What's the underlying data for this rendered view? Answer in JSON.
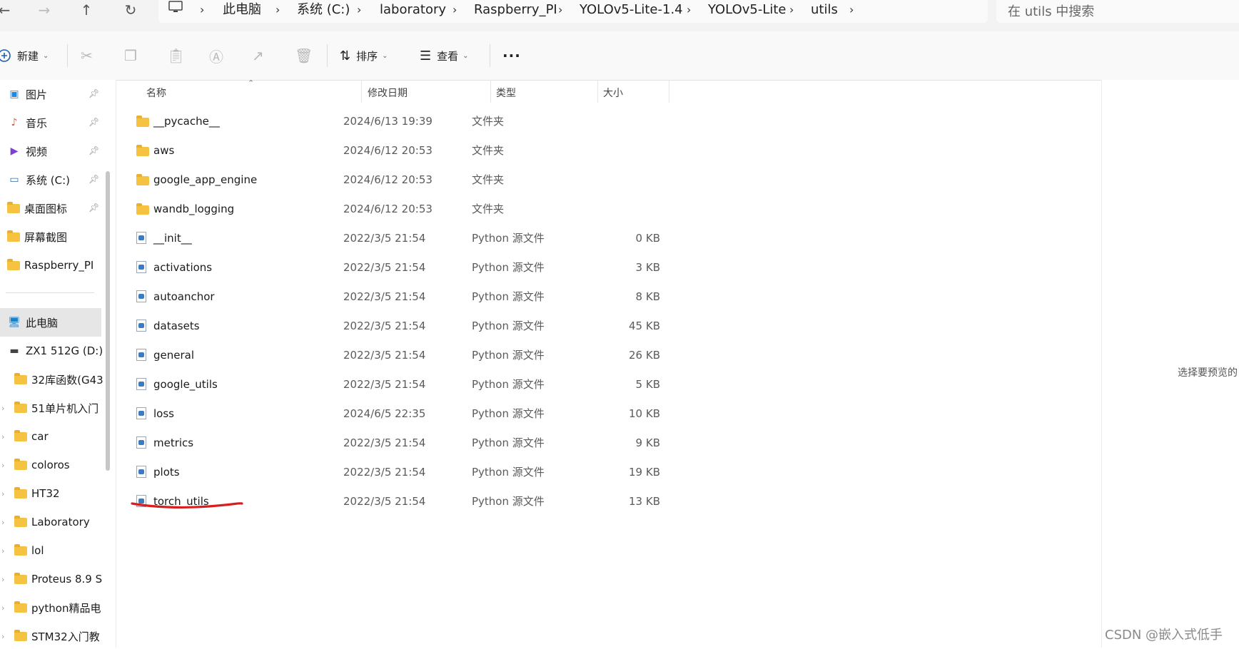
{
  "breadcrumb": [
    "此电脑",
    "系统 (C:)",
    "laboratory",
    "Raspberry_PI",
    "YOLOv5-Lite-1.4",
    "YOLOv5-Lite",
    "utils"
  ],
  "search": {
    "placeholder": "在 utils 中搜索"
  },
  "toolbar": {
    "new_label": "新建",
    "sort_label": "排序",
    "view_label": "查看",
    "more_label": "···"
  },
  "sidebar": {
    "quick_access": [
      {
        "label": "图片",
        "icon": "pictures-icon"
      },
      {
        "label": "音乐",
        "icon": "music-icon"
      },
      {
        "label": "视频",
        "icon": "videos-icon"
      },
      {
        "label": "系统 (C:)",
        "icon": "drive-icon"
      },
      {
        "label": "桌面图标",
        "icon": "folder-icon"
      },
      {
        "label": "屏幕截图",
        "icon": "folder-icon"
      },
      {
        "label": "Raspberry_PI",
        "icon": "folder-icon"
      }
    ],
    "this_pc": "此电脑",
    "drive_d": "ZX1 512G (D:)",
    "folders": [
      "32库函数(G43",
      "51单片机入门",
      "car",
      "coloros",
      "HT32",
      "Laboratory",
      "lol",
      "Proteus 8.9 S",
      "python精品电",
      "STM32入门教"
    ]
  },
  "columns": {
    "name": "名称",
    "date": "修改日期",
    "type": "类型",
    "size": "大小"
  },
  "files": [
    {
      "name": "__pycache__",
      "date": "2024/6/13 19:39",
      "type": "文件夹",
      "size": "",
      "kind": "folder"
    },
    {
      "name": "aws",
      "date": "2024/6/12 20:53",
      "type": "文件夹",
      "size": "",
      "kind": "folder"
    },
    {
      "name": "google_app_engine",
      "date": "2024/6/12 20:53",
      "type": "文件夹",
      "size": "",
      "kind": "folder"
    },
    {
      "name": "wandb_logging",
      "date": "2024/6/12 20:53",
      "type": "文件夹",
      "size": "",
      "kind": "folder"
    },
    {
      "name": "__init__",
      "date": "2022/3/5 21:54",
      "type": "Python 源文件",
      "size": "0 KB",
      "kind": "python"
    },
    {
      "name": "activations",
      "date": "2022/3/5 21:54",
      "type": "Python 源文件",
      "size": "3 KB",
      "kind": "python"
    },
    {
      "name": "autoanchor",
      "date": "2022/3/5 21:54",
      "type": "Python 源文件",
      "size": "8 KB",
      "kind": "python"
    },
    {
      "name": "datasets",
      "date": "2022/3/5 21:54",
      "type": "Python 源文件",
      "size": "45 KB",
      "kind": "python"
    },
    {
      "name": "general",
      "date": "2022/3/5 21:54",
      "type": "Python 源文件",
      "size": "26 KB",
      "kind": "python"
    },
    {
      "name": "google_utils",
      "date": "2022/3/5 21:54",
      "type": "Python 源文件",
      "size": "5 KB",
      "kind": "python"
    },
    {
      "name": "loss",
      "date": "2024/6/5 22:35",
      "type": "Python 源文件",
      "size": "10 KB",
      "kind": "python"
    },
    {
      "name": "metrics",
      "date": "2022/3/5 21:54",
      "type": "Python 源文件",
      "size": "9 KB",
      "kind": "python"
    },
    {
      "name": "plots",
      "date": "2022/3/5 21:54",
      "type": "Python 源文件",
      "size": "19 KB",
      "kind": "python"
    },
    {
      "name": "torch_utils",
      "date": "2022/3/5 21:54",
      "type": "Python 源文件",
      "size": "13 KB",
      "kind": "python"
    }
  ],
  "preview": {
    "text": "选择要预览的"
  },
  "watermark": "CSDN @嵌入式低手",
  "colors": {
    "folder": "#f5c242",
    "annotation": "#d81e1e",
    "selection": "#e6e6e6"
  }
}
